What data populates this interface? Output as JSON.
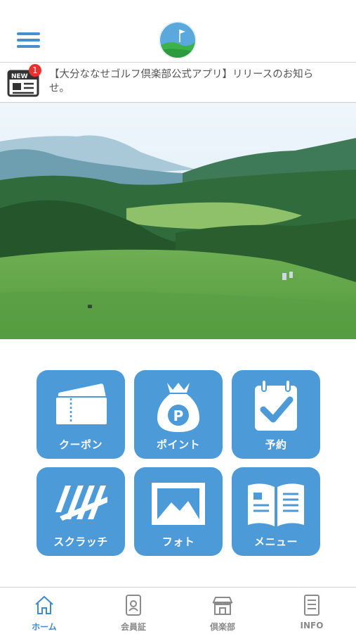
{
  "header": {
    "menu_icon": "hamburger-icon",
    "logo_alt": "OITA NANASE GOLF CLUB"
  },
  "news": {
    "badge_count": "1",
    "icon_label": "NEW",
    "text": "【大分ななせゴルフ倶楽部公式アプリ】リリースのお知らせ。"
  },
  "menu_tiles": [
    {
      "label": "クーポン",
      "icon": "coupon-icon"
    },
    {
      "label": "ポイント",
      "icon": "point-bag-icon"
    },
    {
      "label": "予約",
      "icon": "calendar-check-icon"
    },
    {
      "label": "スクラッチ",
      "icon": "scratch-icon"
    },
    {
      "label": "フォト",
      "icon": "photo-icon"
    },
    {
      "label": "メニュー",
      "icon": "menu-book-icon"
    }
  ],
  "tabs": [
    {
      "label": "ホーム",
      "icon": "home-icon",
      "active": true
    },
    {
      "label": "会員証",
      "icon": "member-card-icon",
      "active": false
    },
    {
      "label": "倶楽部",
      "icon": "shop-icon",
      "active": false
    },
    {
      "label": "INFO",
      "icon": "info-doc-icon",
      "active": false
    }
  ],
  "colors": {
    "accent": "#4c9ad8",
    "tab_active": "#3d8ad1",
    "badge": "#e8312e"
  }
}
